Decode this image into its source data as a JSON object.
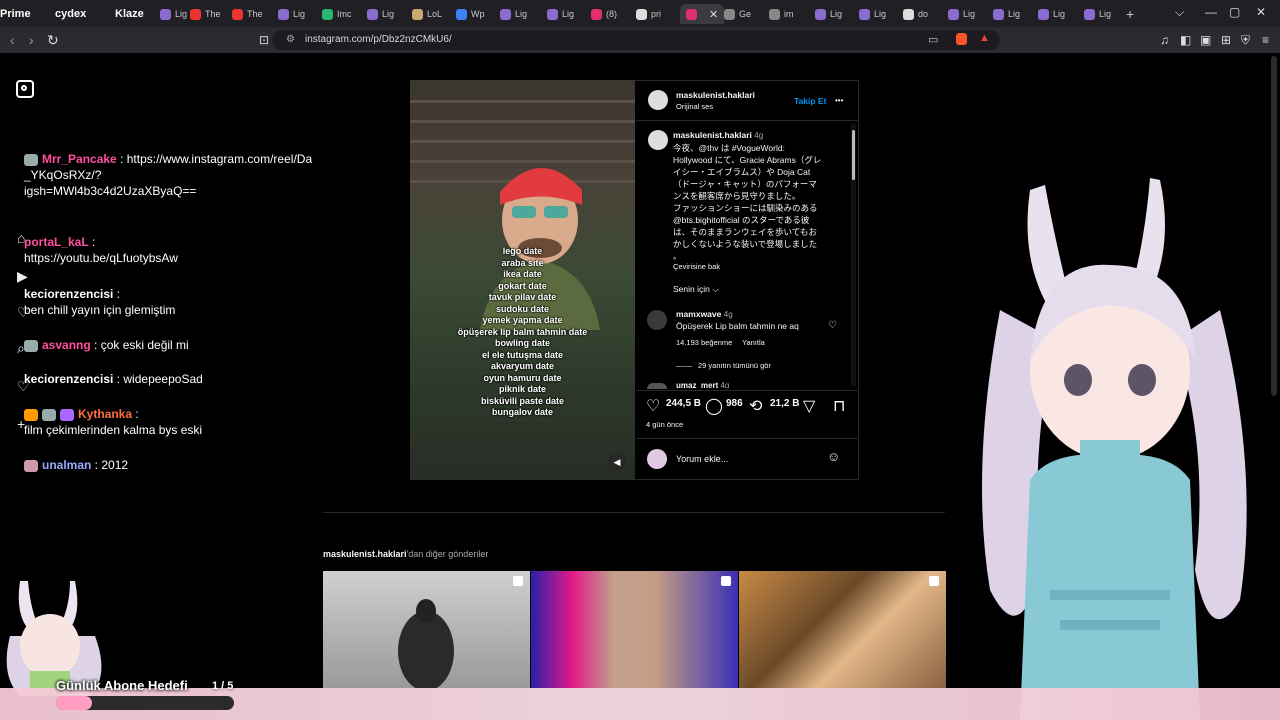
{
  "tabs": [
    {
      "label": "Prime",
      "color": "#333"
    },
    {
      "label": "cydex",
      "color": "#b03a7a"
    },
    {
      "label": "Klaze",
      "color": "#444"
    },
    {
      "label": "Lig",
      "color": "#8a6cd1"
    },
    {
      "label": "The",
      "color": "#e33"
    },
    {
      "label": "The",
      "color": "#e33"
    },
    {
      "label": "Lig",
      "color": "#8a6cd1"
    },
    {
      "label": "Imc",
      "color": "#2bb673"
    },
    {
      "label": "Lig",
      "color": "#8a6cd1"
    },
    {
      "label": "LoL",
      "color": "#c8aa6e"
    },
    {
      "label": "Wp",
      "color": "#3b82f6"
    },
    {
      "label": "Lig",
      "color": "#8a6cd1"
    },
    {
      "label": "Lig",
      "color": "#8a6cd1"
    },
    {
      "label": "(8)",
      "color": "#e1306c"
    },
    {
      "label": "pri",
      "color": "#ddd"
    },
    {
      "label": "",
      "color": "#e1306c"
    },
    {
      "label": "Ge",
      "color": "#888"
    },
    {
      "label": "im",
      "color": "#888"
    },
    {
      "label": "Lig",
      "color": "#8a6cd1"
    },
    {
      "label": "Lig",
      "color": "#8a6cd1"
    },
    {
      "label": "do",
      "color": "#ddd"
    },
    {
      "label": "Lig",
      "color": "#8a6cd1"
    },
    {
      "label": "Lig",
      "color": "#8a6cd1"
    },
    {
      "label": "Lig",
      "color": "#8a6cd1"
    },
    {
      "label": "Lig",
      "color": "#8a6cd1"
    }
  ],
  "browser": {
    "url": "instagram.com/p/Dbz2nzCMkU6/",
    "new_tab": "+",
    "back": "‹",
    "forward": "›",
    "reload": "↻"
  },
  "chat": [
    {
      "user": "Mrr_Pancake",
      "color": "#ff4fa0",
      "text": ": https://www.instagram.com/reel/Da",
      "text2": "_YKqOsRXz/?",
      "text3": "igsh=MWl4b3c4d2UzaXByaQ=="
    },
    {
      "user": "portaL_kaL",
      "color": "#ff4fa0",
      "text": ":",
      "text2": "https://youtu.be/qLfuotybsAw"
    },
    {
      "user": "keciorenzencisi",
      "color": "#ffffff",
      "text": ":",
      "text2": "ben chill yayın için glemiştim"
    },
    {
      "user": "asvanng",
      "color": "#ff4fa0",
      "text": ": çok eski değil mi"
    },
    {
      "user": "keciorenzencisi",
      "color": "#ffffff",
      "text": ": widepeepoSad"
    },
    {
      "user": "Kythanka",
      "color": "#ff6f3c",
      "text": ":",
      "text2": "film çekimlerinden kalma bys eski"
    },
    {
      "user": "unalman",
      "color": "#9aa7ff",
      "text": ": 2012"
    }
  ],
  "post": {
    "username": "maskulenist.haklari",
    "audio": "Orijinal ses",
    "follow": "Takip Et",
    "more": "•••",
    "caption_user": "maskulenist.haklari",
    "caption_age": "4g",
    "caption_lines": [
      "今夜、@thv は #VogueWorld:",
      "Hollywood にて、Gracie Abrams（グレ",
      "イシー・エイブラムス）や Doja Cat",
      "（ドージャ・キャット）のパフォーマ",
      "ンスを観客席から見守りました。",
      "ファッションショーには馴染みのある",
      "@bts.bighitofficial のスターである彼",
      "は、そのままランウェイを歩いてもお",
      "かしくないような装いで登場しました",
      "。"
    ],
    "translate": "Çevirisine bak",
    "for_you": "Senin için ⌵",
    "comment_user": "mamxwave",
    "comment_age": "4g",
    "comment_text": "Öpüşerek Lip balm tahmin ne aq",
    "comment_likes": "14.193 beğenme",
    "reply": "Yanıtla",
    "view_replies": "29 yanıtın tümünü gör",
    "next_user": "umaz_mert",
    "next_age": "4g",
    "likes": "244,5 B",
    "comments": "986",
    "reposts": "21,2 B",
    "date": "4 gün önce",
    "comment_placeholder": "Yorum ekle...",
    "video_caption": [
      "lego date",
      "araba sıte",
      "ikea date",
      "gokart date",
      "tavuk pilav date",
      "sudoku date",
      "yemek yapma date",
      "öpüşerek lip balm tahmin date",
      "bowling date",
      "el ele tutuşma date",
      "akvaryum date",
      "oyun hamuru date",
      "piknik date",
      "bisküvili paste date",
      "bungalov date"
    ]
  },
  "more_posts": {
    "user": "maskulenist.haklari",
    "suffix": "'dan diğer gönderiler"
  },
  "goal": {
    "label": "Günlük Abone Hedefi",
    "count": "1 / 5",
    "fraction": 0.2
  }
}
